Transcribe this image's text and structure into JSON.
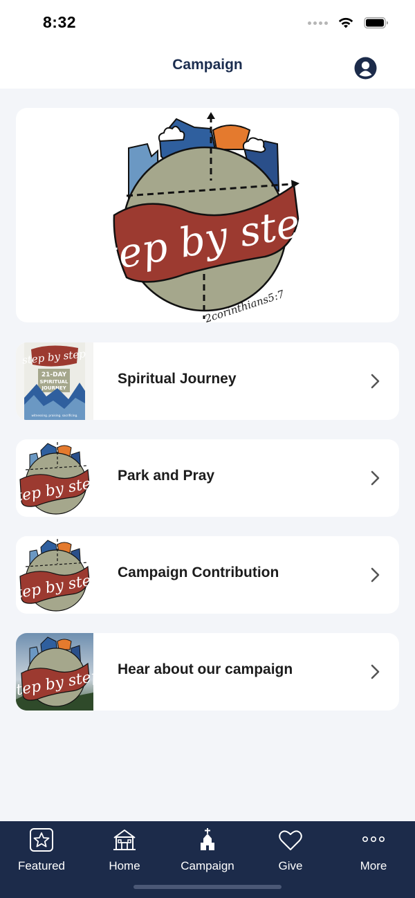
{
  "status_bar": {
    "time": "8:32"
  },
  "header": {
    "title": "Campaign"
  },
  "hero": {
    "logo_text": "step by step",
    "logo_subtext": "2corinthians5:7"
  },
  "list": [
    {
      "label": "Spiritual Journey",
      "thumb_icon": "spiritual-journey-thumbnail"
    },
    {
      "label": "Park and Pray",
      "thumb_icon": "step-by-step-logo-thumbnail"
    },
    {
      "label": "Campaign Contribution",
      "thumb_icon": "step-by-step-logo-thumbnail"
    },
    {
      "label": "Hear about our campaign",
      "thumb_icon": "campaign-video-thumbnail"
    }
  ],
  "thumb1": {
    "title": "21-DAY",
    "title2": "SPIRITUAL",
    "title3": "JOURNEY",
    "footer": "witnessing. praising. sacrificing."
  },
  "tabs": [
    {
      "label": "Featured",
      "icon": "star-icon"
    },
    {
      "label": "Home",
      "icon": "house-icon"
    },
    {
      "label": "Campaign",
      "icon": "church-icon"
    },
    {
      "label": "Give",
      "icon": "heart-icon"
    },
    {
      "label": "More",
      "icon": "more-dots-icon"
    }
  ],
  "colors": {
    "navy": "#1c2b4a",
    "title": "#1b2d4f",
    "banner_red": "#9c3a30",
    "globe": "#a5a78c",
    "mountain_blue": "#2f5f9e",
    "sun_orange": "#e47a2e"
  }
}
